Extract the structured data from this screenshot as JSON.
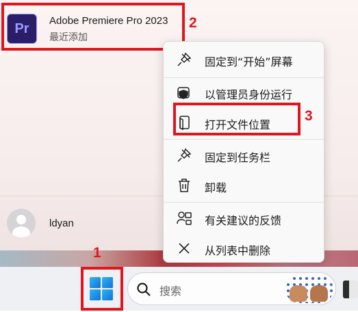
{
  "recent_app": {
    "icon_text": "Pr",
    "name": "Adobe Premiere Pro 2023",
    "subtitle": "最近添加"
  },
  "markers": [
    "1",
    "2",
    "3"
  ],
  "user": {
    "name": "ldyan"
  },
  "context_menu": {
    "items": [
      {
        "label": "固定到“开始”屏幕",
        "icon": "pin-icon"
      },
      {
        "label": "以管理员身份运行",
        "icon": "admin-shield-icon"
      },
      {
        "label": "打开文件位置",
        "icon": "file-location-icon"
      },
      {
        "label": "固定到任务栏",
        "icon": "pin-icon"
      },
      {
        "label": "卸载",
        "icon": "trash-icon"
      },
      {
        "label": "有关建议的反馈",
        "icon": "feedback-icon"
      },
      {
        "label": "从列表中删除",
        "icon": "close-icon"
      }
    ]
  },
  "taskbar": {
    "search_placeholder": "搜索",
    "start_icon": "windows-logo-icon",
    "search_icon": "search-icon"
  },
  "colors": {
    "highlight": "#e0161f",
    "premiere_bg": "#2b1e68",
    "premiere_fg": "#9a9cff",
    "windows_blue": "#1a8fe3"
  }
}
